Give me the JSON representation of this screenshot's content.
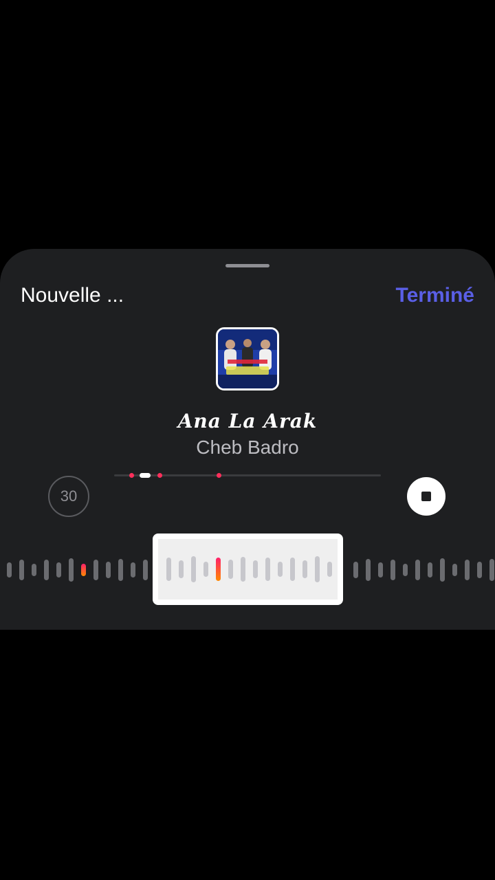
{
  "header": {
    "title": "Nouvelle ...",
    "done_label": "Terminé"
  },
  "track": {
    "title": "Ana La Arak",
    "artist": "Cheb Badro",
    "album_art_icon": "album-cover-image"
  },
  "controls": {
    "duration_label": "30",
    "stop_icon": "stop-icon"
  },
  "colors": {
    "accent": "#5a5fe6",
    "sheet_background": "#1e1f21",
    "marker": "#ff2f5b"
  }
}
